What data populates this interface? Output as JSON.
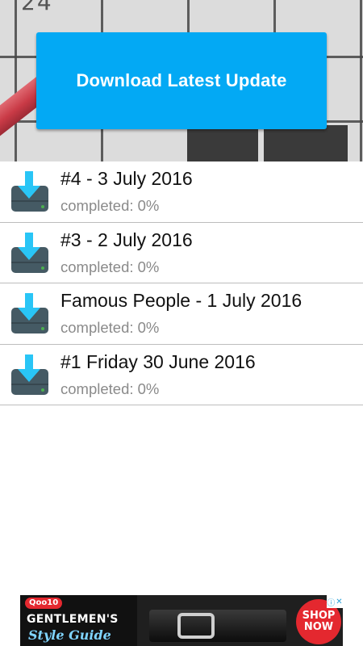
{
  "header": {
    "crossword_cell_number": "24",
    "download_button_label": "Download Latest Update"
  },
  "puzzles": [
    {
      "title": "#4 - 3 July 2016",
      "status": "completed: 0%",
      "icon": "download-drive-icon"
    },
    {
      "title": "#3 - 2 July 2016",
      "status": "completed: 0%",
      "icon": "download-drive-icon"
    },
    {
      "title": "Famous People - 1 July 2016",
      "status": "completed: 0%",
      "icon": "download-drive-icon"
    },
    {
      "title": "#1 Friday 30 June 2016",
      "status": "completed: 0%",
      "icon": "download-drive-icon"
    }
  ],
  "ad": {
    "brand": "Qoo10",
    "line1": "GENTLEMEN'S",
    "line2": "Style Guide",
    "cta_line1": "SHOP",
    "cta_line2": "NOW",
    "info_icon": "info-icon",
    "close_icon": "close-icon"
  },
  "colors": {
    "accent": "#03a9f4",
    "icon_arrow": "#29c5f6",
    "icon_drive": "#455a64",
    "icon_led": "#4caf50"
  }
}
